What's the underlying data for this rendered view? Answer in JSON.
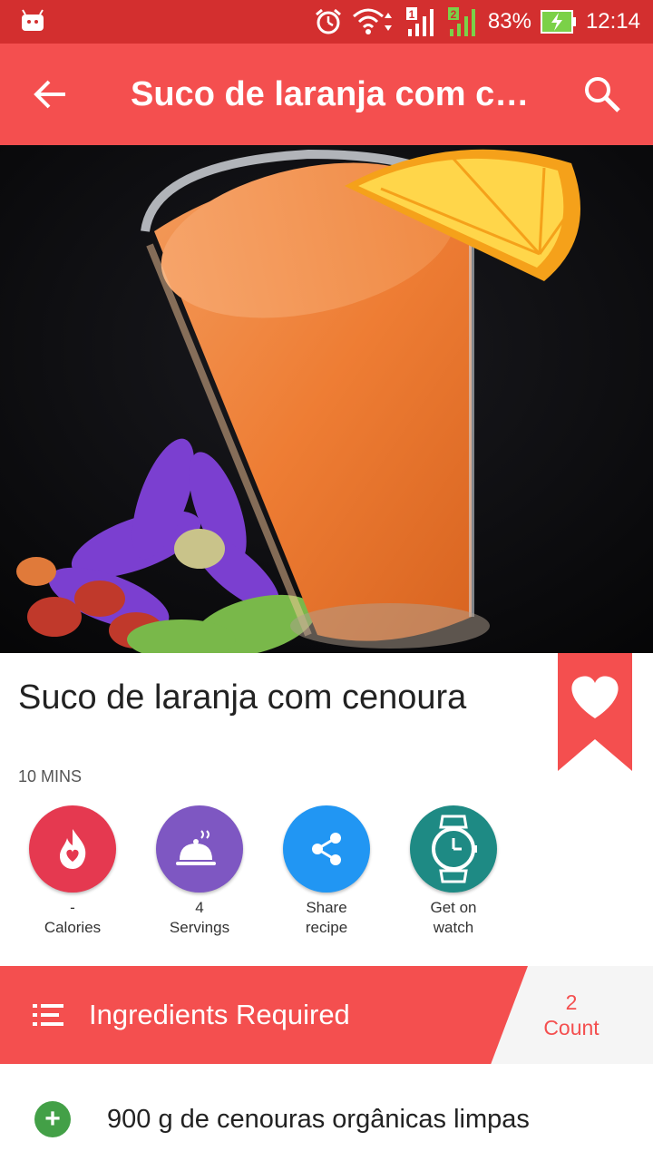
{
  "status_bar": {
    "battery": "83%",
    "time": "12:14",
    "sim1": "1",
    "sim2": "2",
    "icons": [
      "android-icon",
      "alarm-icon",
      "wifi-icon",
      "signal-icon",
      "battery-charging-icon"
    ]
  },
  "app_bar": {
    "title": "Suco de laranja com ce…",
    "back_icon": "arrow-back-icon",
    "search_icon": "search-icon",
    "color": "#f44f4f"
  },
  "recipe": {
    "title": "Suco de laranja com cenoura",
    "time": "10 MINS",
    "bookmark_icon": "heart-icon"
  },
  "actions": [
    {
      "name": "calories",
      "icon": "flame-heart-icon",
      "value": "-",
      "label": "Calories",
      "color": "#e53950"
    },
    {
      "name": "servings",
      "icon": "cloche-icon",
      "value": "4",
      "label": "Servings",
      "color": "#7e57c2"
    },
    {
      "name": "share",
      "icon": "share-icon",
      "value": "Share",
      "label": "recipe",
      "color": "#2196f3"
    },
    {
      "name": "watch",
      "icon": "watch-icon",
      "value": "Get on",
      "label": "watch",
      "color": "#1e8a84"
    }
  ],
  "ingredients": {
    "header": "Ingredients Required",
    "count_value": "2",
    "count_label": "Count",
    "items": [
      {
        "text": "900 g de cenouras orgânicas limpas"
      }
    ]
  }
}
